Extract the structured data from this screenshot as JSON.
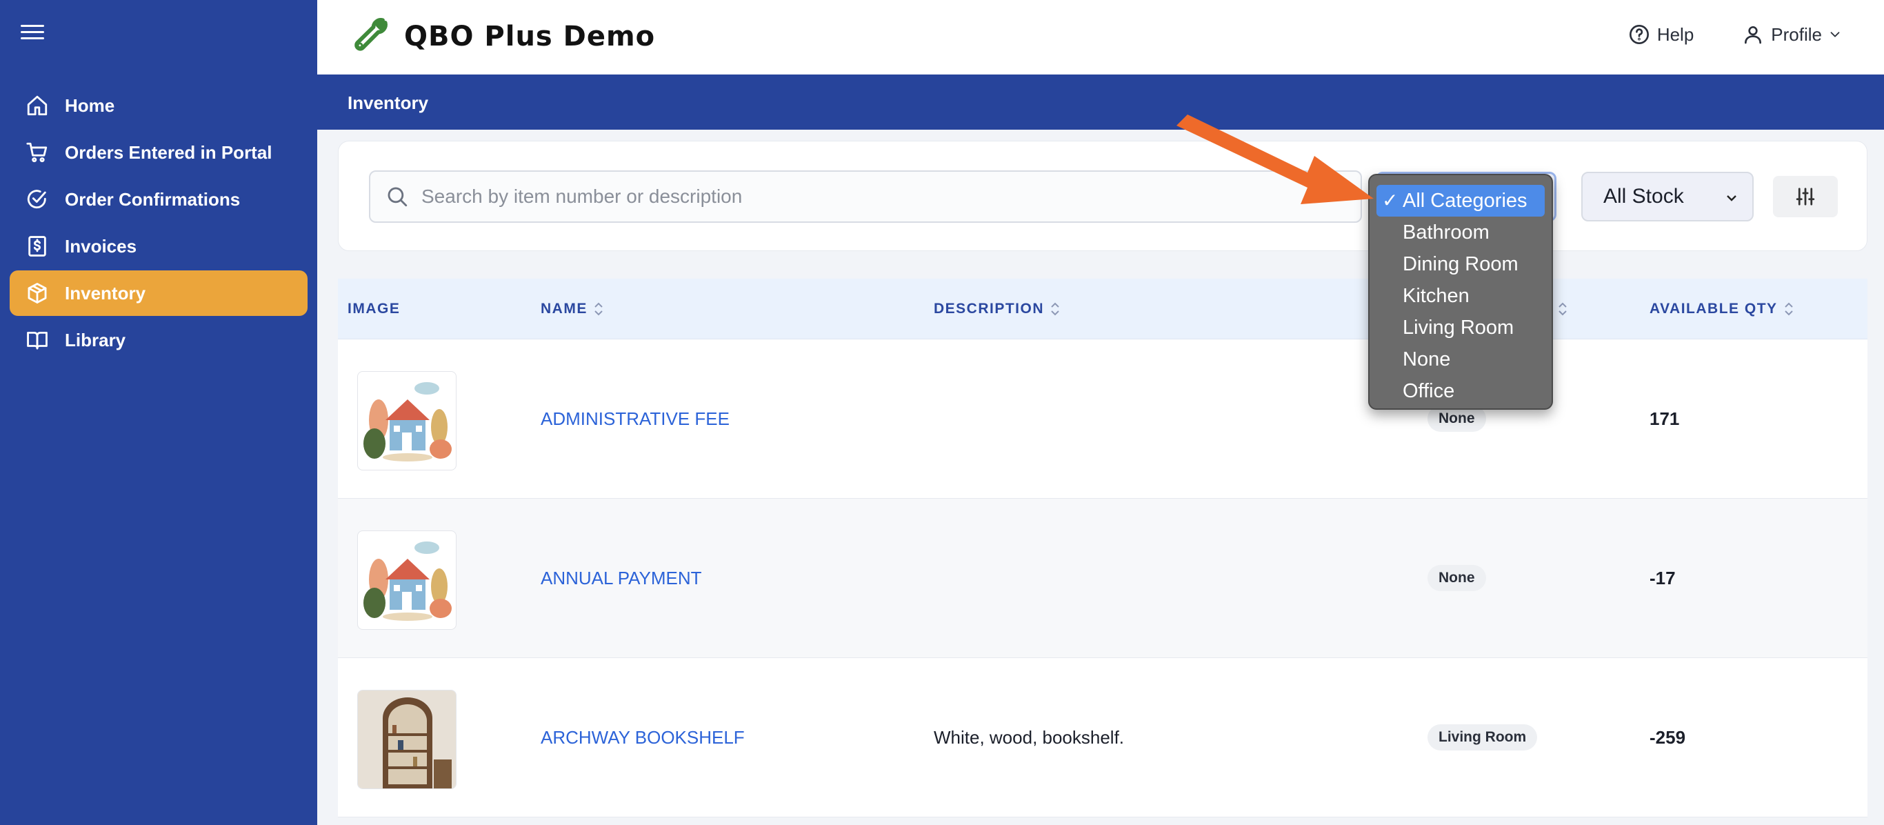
{
  "app": {
    "title": "QBO Plus Demo"
  },
  "sidebar": {
    "items": [
      {
        "label": "Home",
        "icon": "home-icon"
      },
      {
        "label": "Orders Entered in Portal",
        "icon": "cart-icon"
      },
      {
        "label": "Order Confirmations",
        "icon": "check-circle-icon"
      },
      {
        "label": "Invoices",
        "icon": "invoice-dollar-icon"
      },
      {
        "label": "Inventory",
        "icon": "box-icon",
        "active": true
      },
      {
        "label": "Library",
        "icon": "book-icon"
      }
    ]
  },
  "header": {
    "help_label": "Help",
    "profile_label": "Profile"
  },
  "page": {
    "title": "Inventory"
  },
  "filters": {
    "search_placeholder": "Search by item number or description",
    "category_selected": "All Categories",
    "stock_selected": "All Stock",
    "category_options": [
      "All Categories",
      "Bathroom",
      "Dining Room",
      "Kitchen",
      "Living Room",
      "None",
      "Office"
    ]
  },
  "table": {
    "columns": [
      "IMAGE",
      "NAME",
      "DESCRIPTION",
      "AVAILABLE QTY"
    ],
    "rows": [
      {
        "name": "ADMINISTRATIVE FEE",
        "description": "",
        "category": "None",
        "qty": "171"
      },
      {
        "name": "ANNUAL PAYMENT",
        "description": "",
        "category": "None",
        "qty": "-17"
      },
      {
        "name": "ARCHWAY BOOKSHELF",
        "description": "White, wood, bookshelf.",
        "category": "Living Room",
        "qty": "-259"
      }
    ]
  },
  "colors": {
    "sidebar": "#27449b",
    "active": "#eba53b",
    "link": "#2c63d8",
    "annotation_arrow": "#ee6a2a"
  }
}
